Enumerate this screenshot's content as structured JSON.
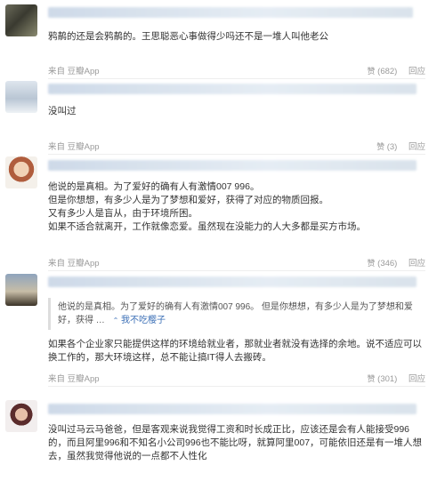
{
  "comments": [
    {
      "text": "鸦䴖的还是会鸦䴖的。王思聪恶心事做得少吗还不是一堆人叫他老公",
      "source": "来自 豆瓣App",
      "likes": "(682)",
      "reply": "回应"
    },
    {
      "text": "没叫过",
      "source": "来自 豆瓣App",
      "likes": "(3)",
      "reply": "回应"
    },
    {
      "text": "他说的是真相。为了爱好的确有人有激情007 996。\n但是你想想，有多少人是为了梦想和爱好，获得了对应的物质回报。\n又有多少人是盲从，由于环境所困。\n如果不适合就离开，工作就像恋爱。虽然现在没能力的人大多都是买方市场。",
      "source": "来自 豆瓣App",
      "likes": "(346)",
      "reply": "回应"
    },
    {
      "quote": "他说的是真相。为了爱好的确有人有激情007 996。  但是你想想，有多少人是为了梦想和爱好，获得 …",
      "collapse": "我不吃樱子",
      "text": "如果各个企业家只能提供这样的环境给就业者，那就业者就没有选择的余地。说不适应可以换工作的，那大环境这样，总不能让搞IT得人去搬砖。",
      "source": "来自 豆瓣App",
      "likes": "(301)",
      "reply": "回应"
    },
    {
      "text": "没叫过马云马爸爸，但是客观来说我觉得工资和时长成正比，应该还是会有人能接受996的，而且阿里996和不知名小公司996也不能比呀，就算阿里007，可能依旧还是有一堆人想去，虽然我觉得他说的一点都不人性化"
    }
  ],
  "icons": {
    "like": "thumbs-up-icon"
  },
  "colors": {
    "link": "#3b6fb6",
    "meta": "#9a9a9a"
  }
}
